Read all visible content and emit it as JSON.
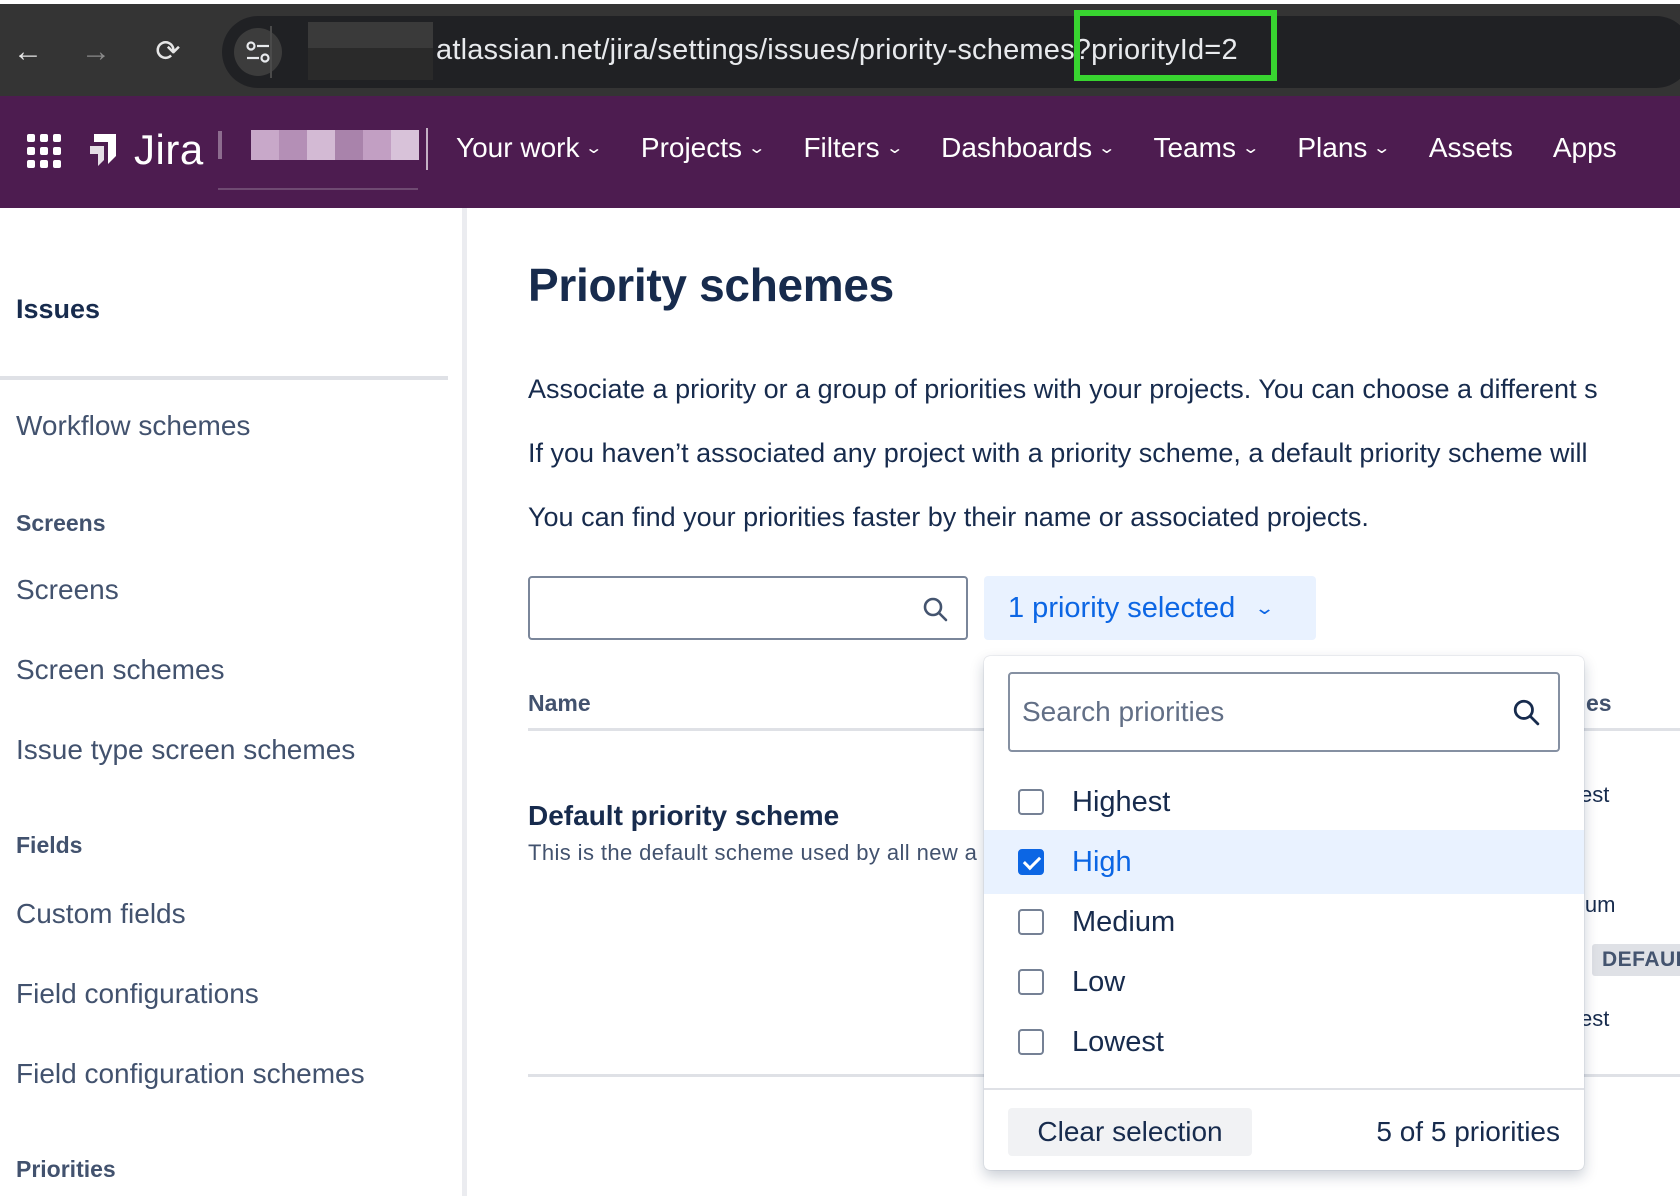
{
  "browser": {
    "url_visible": "atlassian.net/jira/settings/issues/priority-schemes?priorityId=2",
    "nav": {
      "back": "←",
      "forward": "→",
      "reload": "⟳"
    }
  },
  "topnav": {
    "product": "Jira",
    "items": [
      {
        "label": "Your work",
        "dropdown": true
      },
      {
        "label": "Projects",
        "dropdown": true
      },
      {
        "label": "Filters",
        "dropdown": true
      },
      {
        "label": "Dashboards",
        "dropdown": true
      },
      {
        "label": "Teams",
        "dropdown": true
      },
      {
        "label": "Plans",
        "dropdown": true
      },
      {
        "label": "Assets",
        "dropdown": false
      },
      {
        "label": "Apps",
        "dropdown": false
      }
    ],
    "chevron": "⌄"
  },
  "sidebar": {
    "heading": "Issues",
    "workflow_schemes": "Workflow schemes",
    "group_screens": "Screens",
    "screens": "Screens",
    "screen_schemes": "Screen schemes",
    "issue_type_screen_schemes": "Issue type screen schemes",
    "group_fields": "Fields",
    "custom_fields": "Custom fields",
    "field_configurations": "Field configurations",
    "field_configuration_schemes": "Field configuration schemes",
    "group_priorities": "Priorities"
  },
  "main": {
    "title": "Priority schemes",
    "para1": "Associate a priority or a group of priorities with your projects. You can choose a different s",
    "para2": "If you haven’t associated any project with a priority scheme, a default priority scheme will",
    "para3": "You can find your priorities faster by their name or associated projects.",
    "search_value": "",
    "priority_filter_label": "1 priority selected",
    "table": {
      "col_name": "Name",
      "col_right_partial": "es",
      "rows": [
        {
          "name": "Default priority scheme",
          "description": "This is the default scheme used by all new a"
        }
      ],
      "peek_texts": [
        "est",
        "ium",
        "est"
      ],
      "default_lozenge": "DEFAULT"
    }
  },
  "dropdown": {
    "search_placeholder": "Search priorities",
    "options": [
      {
        "label": "Highest",
        "checked": false
      },
      {
        "label": "High",
        "checked": true
      },
      {
        "label": "Medium",
        "checked": false
      },
      {
        "label": "Low",
        "checked": false
      },
      {
        "label": "Lowest",
        "checked": false
      }
    ],
    "clear_label": "Clear selection",
    "count_label": "5 of 5 priorities"
  },
  "colors": {
    "nav_bg": "#4d1c50",
    "accent_blue": "#0c66e4",
    "highlight_green": "#38d430",
    "selected_bg": "#e9f2ff"
  }
}
